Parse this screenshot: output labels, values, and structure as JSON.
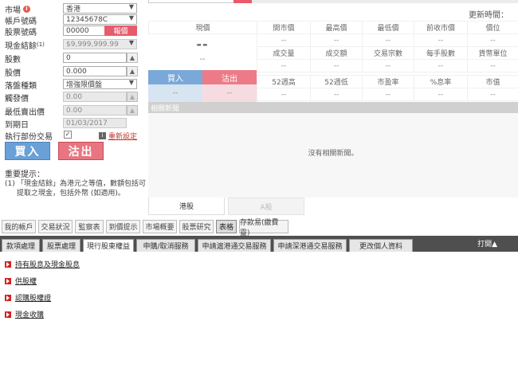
{
  "form": {
    "market_label": "市場",
    "market_value": "香港",
    "account_label": "帳戶號碼",
    "account_value": "12345678C",
    "stock_code_label": "股票號碼",
    "stock_code_value": "00000",
    "quote_button": "報價",
    "cash_balance_label": "現金結餘",
    "cash_balance_sup": "(1)",
    "cash_balance_value": "$9,999,999.99",
    "quantity_label": "股數",
    "quantity_value": "0",
    "price_label": "股價",
    "price_value": "0.000",
    "order_type_label": "落盤種類",
    "order_type_value": "增強限價盤",
    "trigger_price_label": "觸發價",
    "trigger_price_value": "0.00",
    "min_sell_price_label": "最低賣出價",
    "min_sell_price_value": "0.00",
    "expiry_label": "到期日",
    "expiry_value": "01/03/2017",
    "partial_label": "執行部份交易",
    "partial_checked": "✓",
    "reset_link": "重新設定",
    "buy_button": "買入",
    "sell_button": "沽出",
    "notice_title": "重要提示：",
    "notice_num": "(1)",
    "notice_text": "「現金結餘」為港元之等值，數額包括可提取之現金，包括外幣 (如適用)。"
  },
  "quote": {
    "update_time_label": "更新時間：",
    "current_price_header": "現價",
    "price_main": "--",
    "price_sub": "--",
    "row1_headers": [
      "開市價",
      "最高價",
      "最低價",
      "前收市價",
      "價位"
    ],
    "row1_values": [
      "--",
      "--",
      "--",
      "--",
      "--"
    ],
    "row2_headers": [
      "成交量",
      "成交額",
      "交易宗數",
      "每手股數",
      "貨幣單位"
    ],
    "row2_values": [
      "--",
      "--",
      "--",
      "--",
      "--"
    ],
    "row3_headers": [
      "52週高",
      "52週低",
      "市盈率",
      "%息率",
      "市值"
    ],
    "row3_values": [
      "--",
      "--",
      "--",
      "--",
      "--"
    ],
    "bid_label": "買入",
    "ask_label": "沽出",
    "bid_value": "--",
    "ask_value": "--",
    "news_title": "相關新聞",
    "no_news": "沒有相關新聞。",
    "tab_hk": "港股",
    "tab_a": "A股"
  },
  "tabs_row1": [
    "我的帳戶",
    "交易狀況",
    "監察表",
    "到價提示",
    "市場概要",
    "股票研究",
    "表格",
    "存款易(繳費靈)"
  ],
  "tabs_row1_active": "表格",
  "tabs_row2": [
    "款項處理",
    "股票處理",
    "現行股東權益",
    "申購/取消服務",
    "申請滬港通交易服務",
    "申請深港通交易服務",
    "更改個人資料"
  ],
  "tabs_row2_active": "現行股東權益",
  "close_tab": "打開▲",
  "links": [
    "持有股息及現金股息",
    "供股權",
    "認購股權證",
    "現金收購"
  ],
  "colors": {
    "buy": "#6aa0d8",
    "sell": "#e87580",
    "quote_button": "#e85a6c",
    "tab_bar": "#4f4f4f"
  }
}
